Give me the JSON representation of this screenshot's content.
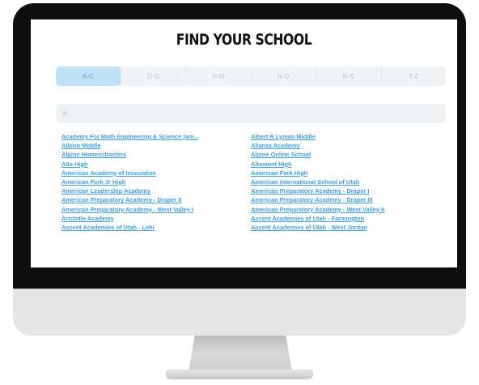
{
  "page": {
    "title": "FIND YOUR SCHOOL"
  },
  "tabs": [
    {
      "label": "A-C",
      "active": true
    },
    {
      "label": "D-G",
      "active": false
    },
    {
      "label": "H-M",
      "active": false
    },
    {
      "label": "N-Q",
      "active": false
    },
    {
      "label": "R-S",
      "active": false
    },
    {
      "label": "T-Z",
      "active": false
    }
  ],
  "search": {
    "value": "",
    "placeholder": "A"
  },
  "schools": [
    "Academy For Math Engineering & Science (am...",
    "Albert R Lyman Middle",
    "Albion Middle",
    "Alianza Academy",
    "Alpine Homeschoolers",
    "Alpine Online School",
    "Alta High",
    "Altamont High",
    "American Academy of Innovation",
    "American Fork High",
    "American Fork Jr High",
    "American International School of Utah",
    "American Leadership Academy",
    "American Preparatory Academy - Draper I",
    "American Preparatory Academy - Draper II",
    "American Preparatory Academy - Draper III",
    "American Preparatory Academy - West Valley I",
    "American Preparatory Academy - West Valley II",
    "Aristotle Academy",
    "Ascent Academies of Utah - Farmington",
    "Ascent Academies of Utah - Lehi",
    "Ascent Academies of Utah - West Jordan"
  ],
  "colors": {
    "bezel": "#0d0d0d",
    "link": "#3d9fdf",
    "active_tab_bg": "#bfe2f7",
    "active_tab_text": "#5aa7d6",
    "tab_bar_bg": "#f1f4f7"
  }
}
